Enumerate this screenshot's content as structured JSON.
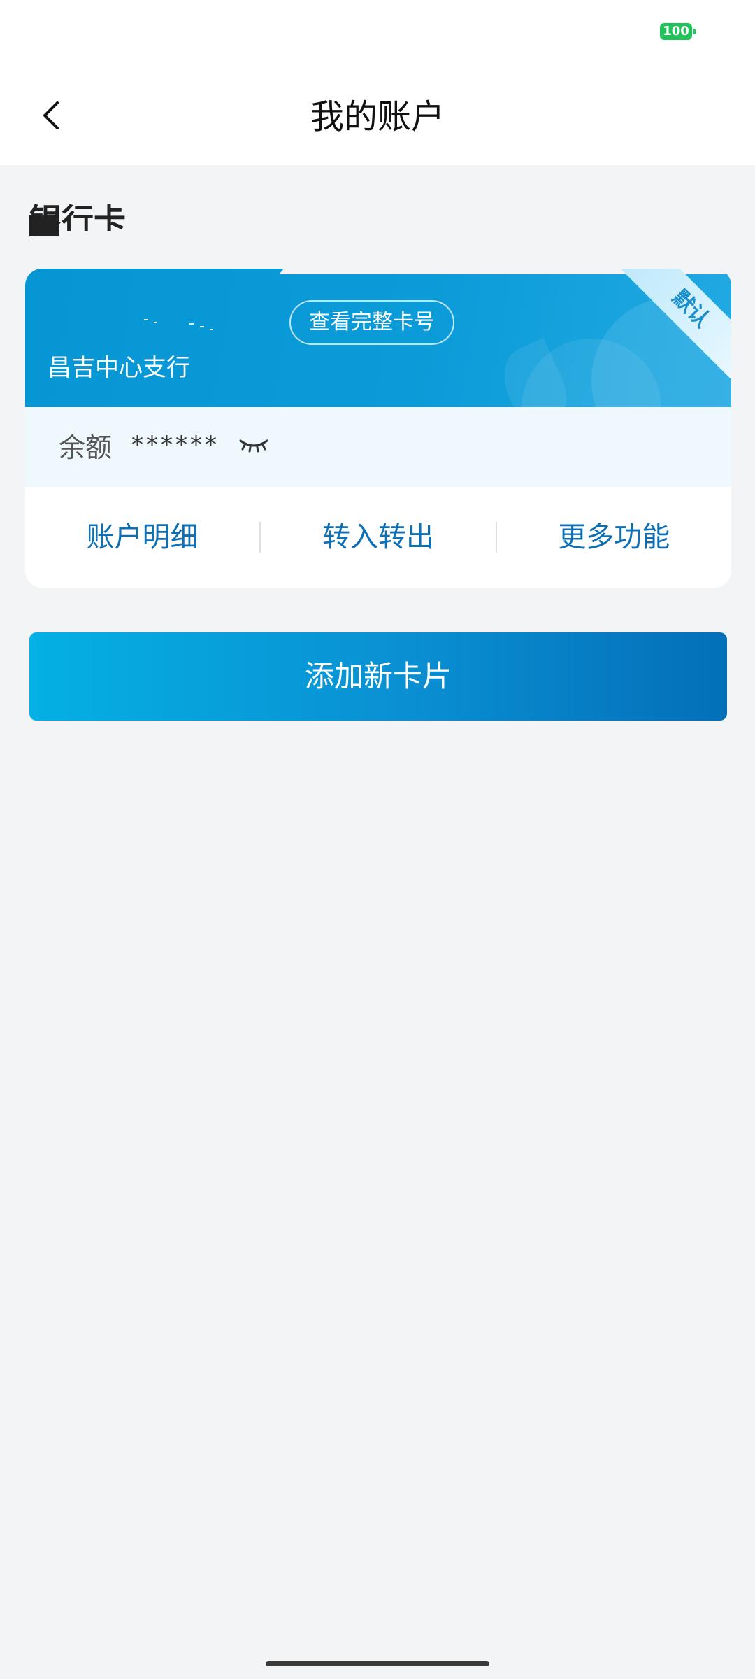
{
  "status_bar": {
    "battery": "100",
    "battery_color": "#22c25a"
  },
  "navbar": {
    "title": "我的账户",
    "back_icon": "chevron-left-icon"
  },
  "section": {
    "heading": "银行卡"
  },
  "card": {
    "default_badge": "默认",
    "view_full_number": "查看完整卡号",
    "branch_name": "昌吉中心支行",
    "balance_label": "余额",
    "balance_value": "******",
    "eye_icon": "eye-closed-icon",
    "actions": [
      {
        "label": "账户明细"
      },
      {
        "label": "转入转出"
      },
      {
        "label": "更多功能"
      }
    ],
    "colors": {
      "header": "#0a9bd8",
      "action_text": "#0e6fb4",
      "balance_bg": "#eef8fd"
    }
  },
  "add_card_button": {
    "label": "添加新卡片",
    "gradient_start": "#04b0e4",
    "gradient_end": "#036fb9"
  }
}
